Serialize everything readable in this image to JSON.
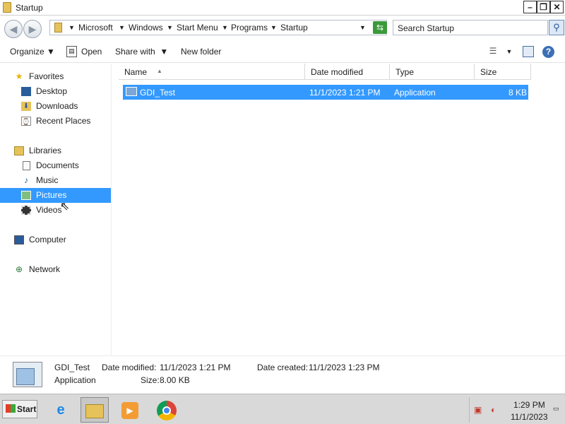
{
  "window": {
    "title": "Startup"
  },
  "address": {
    "breadcrumbs": [
      "Microsoft",
      "Windows",
      "Start Menu",
      "Programs",
      "Startup"
    ],
    "search_placeholder": "Search Startup"
  },
  "toolbar": {
    "organize": "Organize",
    "open": "Open",
    "share_with": "Share with",
    "new_folder": "New folder"
  },
  "navigation": {
    "favorites": {
      "label": "Favorites",
      "items": [
        "Desktop",
        "Downloads",
        "Recent Places"
      ]
    },
    "libraries": {
      "label": "Libraries",
      "items": [
        "Documents",
        "Music",
        "Pictures",
        "Videos"
      ]
    },
    "computer": "Computer",
    "network": "Network",
    "selected": "Pictures"
  },
  "file_list": {
    "columns": [
      "Name",
      "Date modified",
      "Type",
      "Size"
    ],
    "rows": [
      {
        "name": "GDI_Test",
        "date_modified": "11/1/2023 1:21 PM",
        "type": "Application",
        "size": "8 KB"
      }
    ]
  },
  "details_pane": {
    "name": "GDI_Test",
    "type": "Application",
    "date_modified_label": "Date modified:",
    "date_modified": "11/1/2023 1:21 PM",
    "size_label": "Size:",
    "size": "8.00 KB",
    "date_created_label": "Date created:",
    "date_created": "11/1/2023 1:23 PM"
  },
  "taskbar": {
    "start_label": "Start",
    "apps": [
      "internet-explorer-icon",
      "file-explorer-icon",
      "media-player-icon",
      "chrome-icon"
    ],
    "clock_time": "1:29 PM",
    "clock_date": "11/1/2023"
  },
  "colors": {
    "selection": "#3399ff",
    "taskbar": "#d9d9d9"
  }
}
